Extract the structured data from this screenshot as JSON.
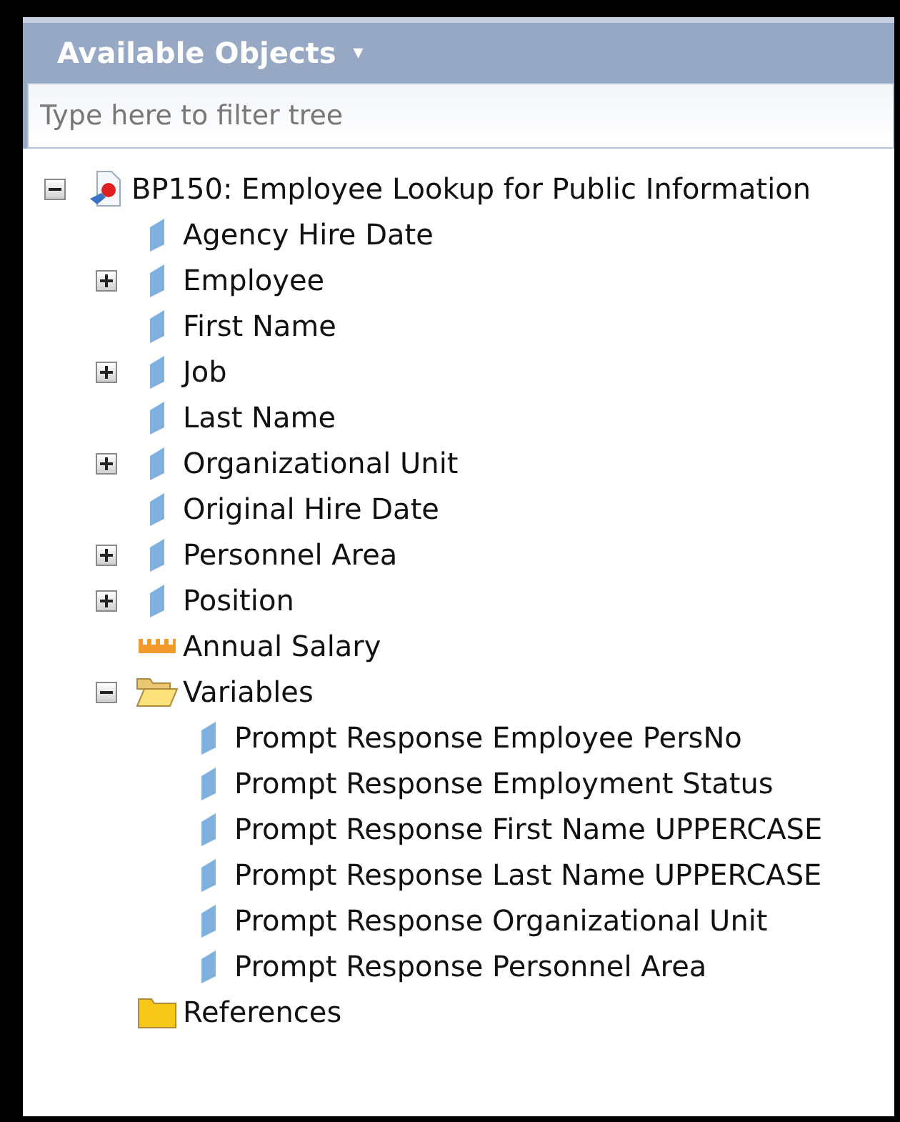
{
  "panel": {
    "title": "Available Objects",
    "menu_glyph": "▾"
  },
  "filter": {
    "placeholder": "Type here to filter tree"
  },
  "tree": [
    {
      "label": "BP150: Employee Lookup for Public Information",
      "kind": "document",
      "expanded": true,
      "children": [
        {
          "label": "Agency Hire Date",
          "kind": "dimension"
        },
        {
          "label": "Employee",
          "kind": "dimension",
          "expanded": false
        },
        {
          "label": "First Name",
          "kind": "dimension"
        },
        {
          "label": "Job",
          "kind": "dimension",
          "expanded": false
        },
        {
          "label": "Last Name",
          "kind": "dimension"
        },
        {
          "label": "Organizational Unit",
          "kind": "dimension",
          "expanded": false
        },
        {
          "label": "Original Hire Date",
          "kind": "dimension"
        },
        {
          "label": "Personnel Area",
          "kind": "dimension",
          "expanded": false
        },
        {
          "label": "Position",
          "kind": "dimension",
          "expanded": false
        },
        {
          "label": "Annual Salary",
          "kind": "measure"
        },
        {
          "label": "Variables",
          "kind": "folder",
          "expanded": true,
          "children": [
            {
              "label": "Prompt Response Employee PersNo",
              "kind": "dimension"
            },
            {
              "label": "Prompt Response Employment Status",
              "kind": "dimension"
            },
            {
              "label": "Prompt Response First Name UPPERCASE",
              "kind": "dimension"
            },
            {
              "label": "Prompt Response Last Name UPPERCASE",
              "kind": "dimension"
            },
            {
              "label": "Prompt Response Organizational Unit",
              "kind": "dimension"
            },
            {
              "label": "Prompt Response Personnel Area",
              "kind": "dimension"
            }
          ]
        },
        {
          "label": "References",
          "kind": "folder"
        }
      ]
    }
  ]
}
